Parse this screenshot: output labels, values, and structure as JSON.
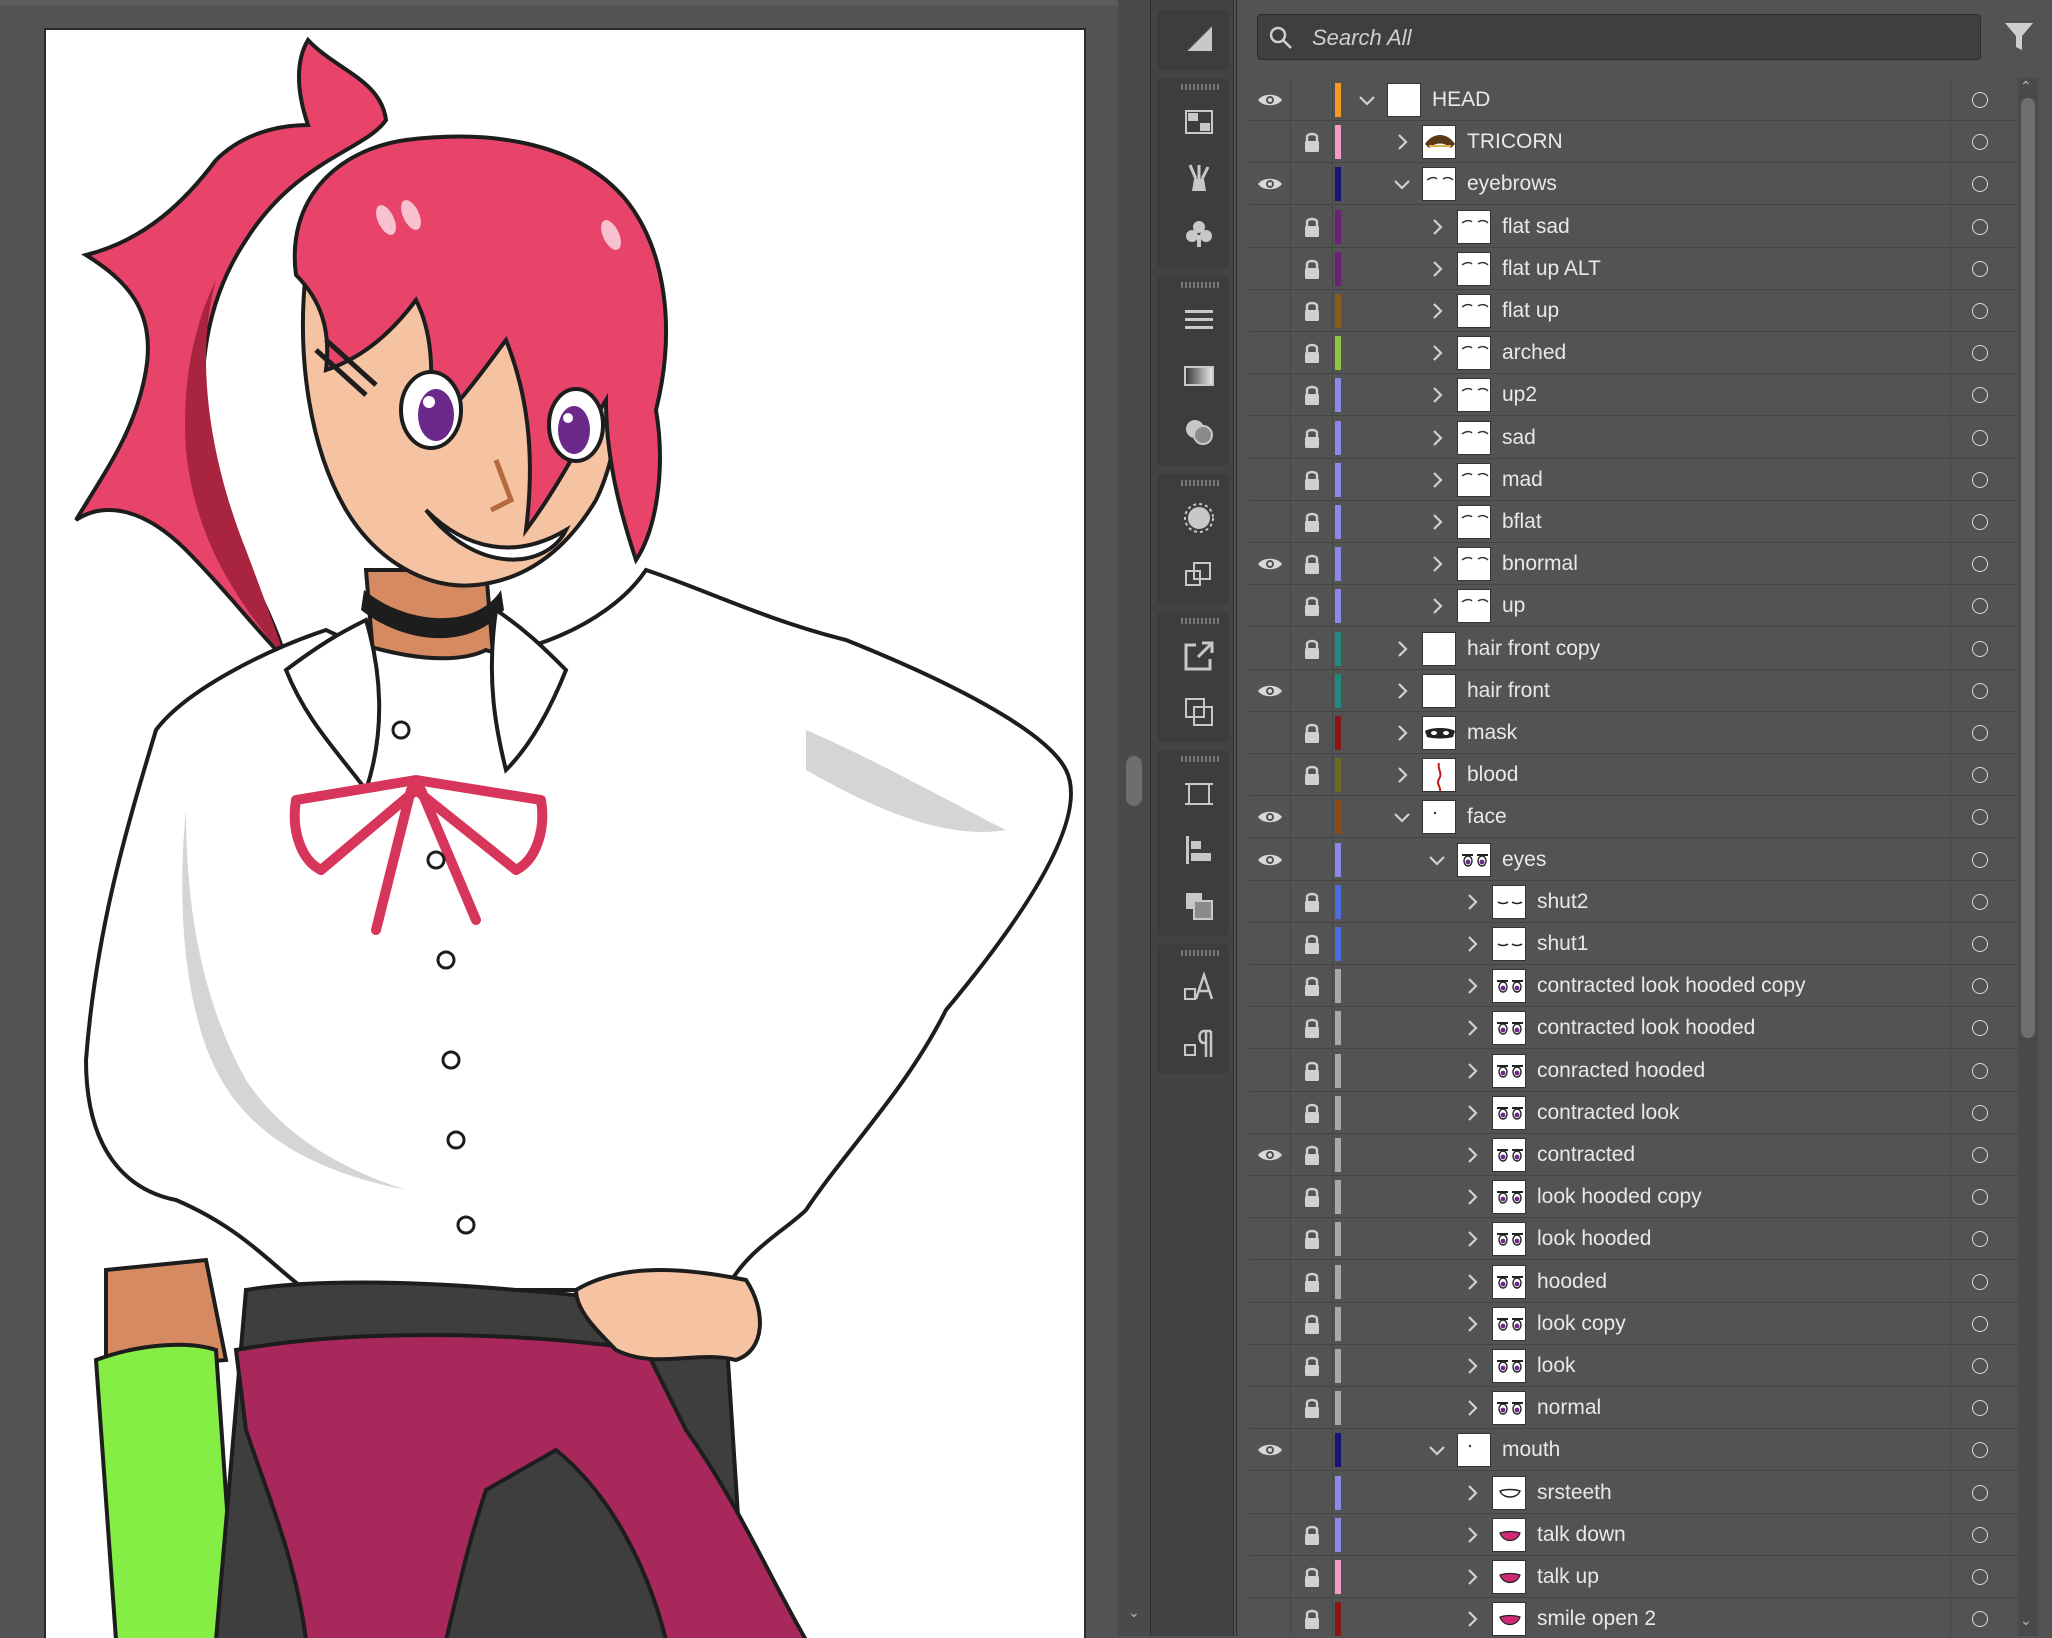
{
  "search": {
    "placeholder": "Search All"
  },
  "tools": [
    "shaper-icon",
    "symbols-grid-icon",
    "brushes-icon",
    "clubs-symbol-icon",
    "stroke-lines-icon",
    "gradient-icon",
    "transparency-icon",
    "appearance-icon",
    "transform-icon",
    "export-icon",
    "pathfinder-icon",
    "artboard-icon",
    "align-icon",
    "layers-stack-icon",
    "character-icon",
    "paragraph-icon"
  ],
  "layers": [
    {
      "name": "HEAD",
      "depth": 0,
      "expanded": true,
      "visible": true,
      "locked": false,
      "color": "#f59a1e",
      "thumb": "blank"
    },
    {
      "name": "TRICORN",
      "depth": 1,
      "expanded": false,
      "visible": false,
      "locked": true,
      "color": "#f29ac8",
      "thumb": "hat"
    },
    {
      "name": "eyebrows",
      "depth": 1,
      "expanded": true,
      "visible": true,
      "locked": false,
      "color": "#14147a",
      "thumb": "brows"
    },
    {
      "name": "flat sad",
      "depth": 2,
      "expanded": false,
      "visible": false,
      "locked": true,
      "color": "#6e1f7a",
      "thumb": "brows"
    },
    {
      "name": "flat up ALT",
      "depth": 2,
      "expanded": false,
      "visible": false,
      "locked": true,
      "color": "#6e1f7a",
      "thumb": "brows"
    },
    {
      "name": "flat up",
      "depth": 2,
      "expanded": false,
      "visible": false,
      "locked": true,
      "color": "#8b5a1a",
      "thumb": "brows"
    },
    {
      "name": "arched",
      "depth": 2,
      "expanded": false,
      "visible": false,
      "locked": true,
      "color": "#8ec63f",
      "thumb": "brows"
    },
    {
      "name": "up2",
      "depth": 2,
      "expanded": false,
      "visible": false,
      "locked": true,
      "color": "#8a8ae6",
      "thumb": "brows"
    },
    {
      "name": "sad",
      "depth": 2,
      "expanded": false,
      "visible": false,
      "locked": true,
      "color": "#8a8ae6",
      "thumb": "brows"
    },
    {
      "name": "mad",
      "depth": 2,
      "expanded": false,
      "visible": false,
      "locked": true,
      "color": "#8a8ae6",
      "thumb": "brows"
    },
    {
      "name": "bflat",
      "depth": 2,
      "expanded": false,
      "visible": false,
      "locked": true,
      "color": "#8a8ae6",
      "thumb": "brows"
    },
    {
      "name": "bnormal",
      "depth": 2,
      "expanded": false,
      "visible": true,
      "locked": true,
      "color": "#8a8ae6",
      "thumb": "brows"
    },
    {
      "name": "up",
      "depth": 2,
      "expanded": false,
      "visible": false,
      "locked": true,
      "color": "#8a8ae6",
      "thumb": "brows"
    },
    {
      "name": "hair front copy",
      "depth": 1,
      "expanded": false,
      "visible": false,
      "locked": true,
      "color": "#1f8a80",
      "thumb": "blank"
    },
    {
      "name": "hair front",
      "depth": 1,
      "expanded": false,
      "visible": true,
      "locked": false,
      "color": "#1f8a80",
      "thumb": "blank"
    },
    {
      "name": "mask",
      "depth": 1,
      "expanded": false,
      "visible": false,
      "locked": true,
      "color": "#8b1414",
      "thumb": "mask"
    },
    {
      "name": "blood",
      "depth": 1,
      "expanded": false,
      "visible": false,
      "locked": true,
      "color": "#6b6b1f",
      "thumb": "blood"
    },
    {
      "name": "face",
      "depth": 1,
      "expanded": true,
      "visible": true,
      "locked": false,
      "color": "#8b4a1a",
      "thumb": "dot"
    },
    {
      "name": "eyes",
      "depth": 2,
      "expanded": true,
      "visible": true,
      "locked": false,
      "color": "#8a8ae6",
      "thumb": "eyes"
    },
    {
      "name": "shut2",
      "depth": 3,
      "expanded": false,
      "visible": false,
      "locked": true,
      "color": "#4a6ee0",
      "thumb": "shut"
    },
    {
      "name": "shut1",
      "depth": 3,
      "expanded": false,
      "visible": false,
      "locked": true,
      "color": "#4a6ee0",
      "thumb": "shut"
    },
    {
      "name": "contracted look hooded copy",
      "depth": 3,
      "expanded": false,
      "visible": false,
      "locked": true,
      "color": "#a8a8a8",
      "thumb": "eyes"
    },
    {
      "name": "contracted look hooded",
      "depth": 3,
      "expanded": false,
      "visible": false,
      "locked": true,
      "color": "#a8a8a8",
      "thumb": "eyes"
    },
    {
      "name": "conracted hooded",
      "depth": 3,
      "expanded": false,
      "visible": false,
      "locked": true,
      "color": "#a8a8a8",
      "thumb": "eyes"
    },
    {
      "name": "contracted look",
      "depth": 3,
      "expanded": false,
      "visible": false,
      "locked": true,
      "color": "#a8a8a8",
      "thumb": "eyes"
    },
    {
      "name": "contracted",
      "depth": 3,
      "expanded": false,
      "visible": true,
      "locked": true,
      "color": "#a8a8a8",
      "thumb": "eyes"
    },
    {
      "name": "look hooded copy",
      "depth": 3,
      "expanded": false,
      "visible": false,
      "locked": true,
      "color": "#a8a8a8",
      "thumb": "eyes"
    },
    {
      "name": "look hooded",
      "depth": 3,
      "expanded": false,
      "visible": false,
      "locked": true,
      "color": "#a8a8a8",
      "thumb": "eyes"
    },
    {
      "name": "hooded",
      "depth": 3,
      "expanded": false,
      "visible": false,
      "locked": true,
      "color": "#a8a8a8",
      "thumb": "eyes"
    },
    {
      "name": "look copy",
      "depth": 3,
      "expanded": false,
      "visible": false,
      "locked": true,
      "color": "#a8a8a8",
      "thumb": "eyes"
    },
    {
      "name": "look",
      "depth": 3,
      "expanded": false,
      "visible": false,
      "locked": true,
      "color": "#a8a8a8",
      "thumb": "eyes"
    },
    {
      "name": "normal",
      "depth": 3,
      "expanded": false,
      "visible": false,
      "locked": true,
      "color": "#a8a8a8",
      "thumb": "eyes"
    },
    {
      "name": "mouth",
      "depth": 2,
      "expanded": true,
      "visible": true,
      "locked": false,
      "color": "#14147a",
      "thumb": "dot"
    },
    {
      "name": "srsteeth",
      "depth": 3,
      "expanded": false,
      "visible": false,
      "locked": false,
      "color": "#8a8ae6",
      "thumb": "teeth"
    },
    {
      "name": "talk down",
      "depth": 3,
      "expanded": false,
      "visible": false,
      "locked": true,
      "color": "#8a8ae6",
      "thumb": "lips"
    },
    {
      "name": "talk up",
      "depth": 3,
      "expanded": false,
      "visible": false,
      "locked": true,
      "color": "#f29ac8",
      "thumb": "lips"
    },
    {
      "name": "smile open 2",
      "depth": 3,
      "expanded": false,
      "visible": false,
      "locked": true,
      "color": "#8b1414",
      "thumb": "lips"
    }
  ]
}
